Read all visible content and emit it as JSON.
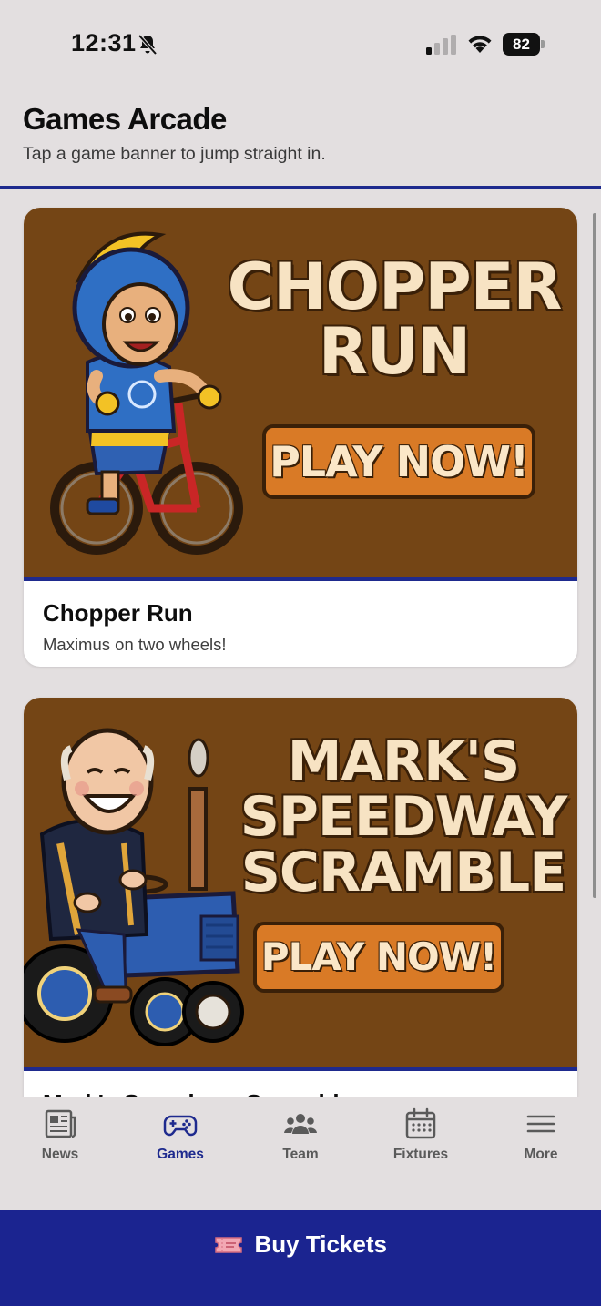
{
  "status_bar": {
    "time": "12:31",
    "battery": "82"
  },
  "header": {
    "title": "Games Arcade",
    "subtitle": "Tap a game banner to jump straight in."
  },
  "games": [
    {
      "banner_title": "CHOPPER RUN",
      "banner_cta": "PLAY NOW!",
      "title": "Chopper Run",
      "description": "Maximus on two wheels!"
    },
    {
      "banner_title": "MARK'S SPEEDWAY SCRAMBLE",
      "banner_cta": "PLAY NOW!",
      "title": "Mark's Speedway Scramble",
      "description": ""
    }
  ],
  "tab_bar": {
    "items": [
      {
        "label": "News",
        "icon": "newspaper-icon",
        "active": false
      },
      {
        "label": "Games",
        "icon": "gamepad-icon",
        "active": true
      },
      {
        "label": "Team",
        "icon": "team-icon",
        "active": false
      },
      {
        "label": "Fixtures",
        "icon": "calendar-icon",
        "active": false
      },
      {
        "label": "More",
        "icon": "menu-icon",
        "active": false
      }
    ]
  },
  "buy_tickets": {
    "label": "Buy Tickets",
    "icon": "ticket-icon"
  },
  "colors": {
    "accent": "#1e2a8e",
    "banner_bg": "#744515",
    "cta": "#d97a26",
    "page_bg": "#e3dfe0"
  }
}
